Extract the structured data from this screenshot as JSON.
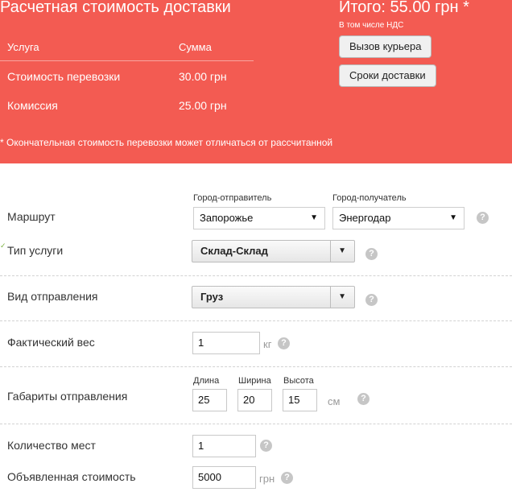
{
  "summary": {
    "title": "Расчетная стоимость доставки",
    "col_service": "Услуга",
    "col_sum": "Сумма",
    "rows": [
      {
        "service": "Стоимость перевозки",
        "sum": "30.00 грн"
      },
      {
        "service": "Комиссия",
        "sum": "25.00 грн"
      }
    ],
    "total": "Итого: 55.00 грн *",
    "vat_note": "В том числе НДС",
    "courier_button": "Вызов курьера",
    "delivery_time_button": "Сроки доставки",
    "footnote": "* Окончательная стоимость перевозки может отличаться от рассчитанной"
  },
  "form": {
    "route": {
      "label": "Маршрут",
      "sender_city_label": "Город-отправитель",
      "sender_city": "Запорожье",
      "recipient_city_label": "Город-получатель",
      "recipient_city": "Энергодар"
    },
    "service_type": {
      "label": "Тип услуги",
      "value": "Склад-Склад"
    },
    "shipment_kind": {
      "label": "Вид отправления",
      "value": "Груз"
    },
    "weight": {
      "label": "Фактический вес",
      "value": "1",
      "unit": "кг"
    },
    "dimensions": {
      "label": "Габариты отправления",
      "length_label": "Длина",
      "length": "25",
      "width_label": "Ширина",
      "width": "20",
      "height_label": "Высота",
      "height": "15",
      "unit": "см"
    },
    "places": {
      "label": "Количество мест",
      "value": "1"
    },
    "declared_value": {
      "label": "Объявленная стоимость",
      "value": "5000",
      "unit": "грн"
    },
    "help_symbol": "?",
    "dropdown_arrow": "▼",
    "check_mark": "✓"
  },
  "colors": {
    "summary_bg": "#f35b52",
    "help_icon": "#c6c6c6"
  }
}
